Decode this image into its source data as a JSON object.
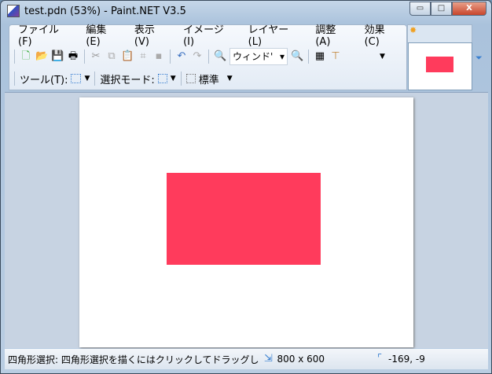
{
  "window": {
    "title": "test.pdn (53%) - Paint.NET V3.5",
    "minimize": "▭",
    "maximize": "□",
    "close": "X"
  },
  "menu": [
    "ファイル(F)",
    "編集(E)",
    "表示(V)",
    "イメージ(I)",
    "レイヤー(L)",
    "調整(A)",
    "効果(C)"
  ],
  "toolbar": {
    "zoom_value": "ウィンド'",
    "tool_label": "ツール(T):",
    "selection_mode_label": "選択モード:",
    "antialias_label": "標準"
  },
  "canvas": {
    "shape_color": "#ff3b5c",
    "background": "#ffffff"
  },
  "status": {
    "hint": "四角形選択: 四角形選択を描くにはクリックしてドラッグし",
    "image_size": "800 x 600",
    "cursor_position": "-169, -9"
  }
}
